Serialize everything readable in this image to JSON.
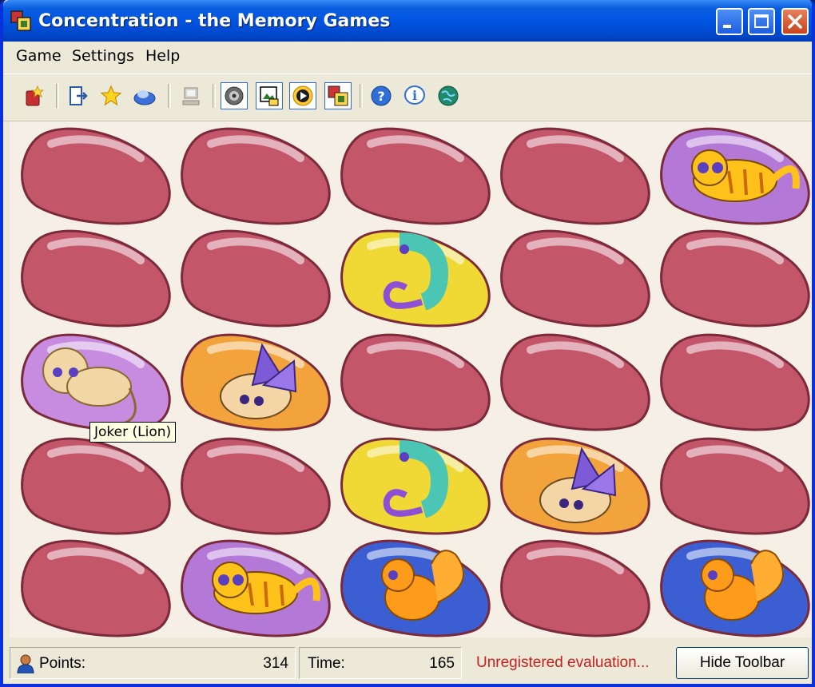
{
  "window": {
    "title": "Concentration - the Memory Games"
  },
  "menu": [
    "Game",
    "Settings",
    "Help"
  ],
  "toolbar": {
    "buttons": [
      {
        "icon": "new-game-icon"
      },
      {
        "icon": "exit-door-icon"
      },
      {
        "icon": "star-icon"
      },
      {
        "icon": "hint-disc-icon"
      },
      {
        "icon": "computer-icon"
      },
      {
        "icon": "sound-icon",
        "pressed": true
      },
      {
        "icon": "picture-icon",
        "pressed": true
      },
      {
        "icon": "music-play-icon",
        "pressed": true
      },
      {
        "icon": "theme-icon",
        "pressed": true
      },
      {
        "icon": "help-icon"
      },
      {
        "icon": "info-icon"
      },
      {
        "icon": "web-globe-icon"
      }
    ]
  },
  "board": {
    "rows": 5,
    "cols": 5,
    "cells": [
      [
        "hidden",
        "hidden",
        "hidden",
        "hidden",
        "tiger"
      ],
      [
        "hidden",
        "hidden",
        "chameleon",
        "hidden",
        "hidden"
      ],
      [
        "lion",
        "bug",
        "hidden",
        "hidden",
        "hidden"
      ],
      [
        "hidden",
        "hidden",
        "chameleon",
        "bug",
        "hidden"
      ],
      [
        "hidden",
        "tiger",
        "squirrel",
        "hidden",
        "squirrel"
      ]
    ],
    "card_colors": {
      "hidden": "#c4566a",
      "tiger": "#b479d6",
      "chameleon": "#f0d934",
      "lion": "#c78ce0",
      "bug": "#f2a33b",
      "squirrel": "#3b5fd3"
    }
  },
  "tooltip": "Joker (Lion)",
  "status": {
    "points_label": "Points:",
    "points_value": "314",
    "time_label": "Time:",
    "time_value": "165",
    "message": "Unregistered evaluation...",
    "message_color": "#c81e1e",
    "hide_toolbar_label": "Hide Toolbar"
  }
}
